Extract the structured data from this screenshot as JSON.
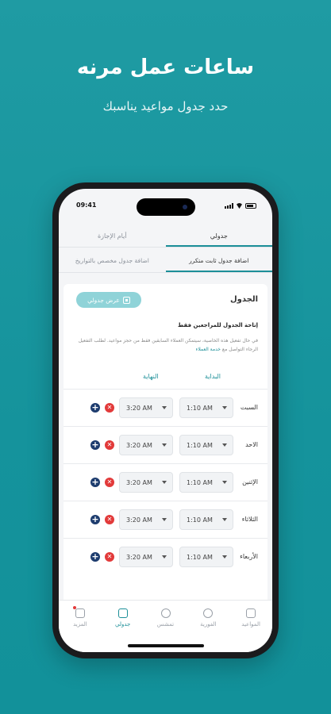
{
  "hero": {
    "title": "ساعات عمل مرنه",
    "subtitle": "حدد جدول مواعيد يناسبك"
  },
  "status_bar": {
    "time": "09:41"
  },
  "tabs_primary": [
    {
      "label": "جدولي",
      "active": true
    },
    {
      "label": "أيام الإجازة",
      "active": false
    }
  ],
  "tabs_secondary": [
    {
      "label": "اضافة جدول ثابت متكرر",
      "active": true
    },
    {
      "label": "اضافة جدول مخصص بالتواريخ",
      "active": false
    }
  ],
  "schedule": {
    "title": "الجدول",
    "view_button": "عرض جدولي",
    "rule_title": "إتاحة الجدول للمراجعين فقط",
    "rule_text": "في حال تفعيل هذه الخاصية، سيتمكن العملاء السابقين فقط من حجز مواعيد. لطلب التفعيل الرجاء التواصل مع",
    "rule_link": "خدمة العملاء",
    "col_start": "البداية",
    "col_end": "النهاية",
    "rows": [
      {
        "day": "السبت",
        "start": "1:10 AM",
        "end": "3:20 AM"
      },
      {
        "day": "الاحد",
        "start": "1:10 AM",
        "end": "3:20 AM"
      },
      {
        "day": "الإثنين",
        "start": "1:10 AM",
        "end": "3:20 AM"
      },
      {
        "day": "الثلاثاء",
        "start": "1:10 AM",
        "end": "3:20 AM"
      },
      {
        "day": "الأربعاء",
        "start": "1:10 AM",
        "end": "3:20 AM"
      }
    ]
  },
  "bottom_nav": [
    {
      "label": "المواعيد",
      "icon": "calendar-icon",
      "active": false
    },
    {
      "label": "الفورية",
      "icon": "alarm-icon",
      "active": false
    },
    {
      "label": "تمشس",
      "icon": "signal-icon",
      "active": false
    },
    {
      "label": "جدولي",
      "icon": "schedule-icon",
      "active": true
    },
    {
      "label": "المزيد",
      "icon": "grid-icon",
      "active": false,
      "badge": true
    }
  ],
  "colors": {
    "accent": "#1c8f98",
    "background": "#15939c",
    "add": "#1d3c6e",
    "delete": "#e23a3a"
  }
}
